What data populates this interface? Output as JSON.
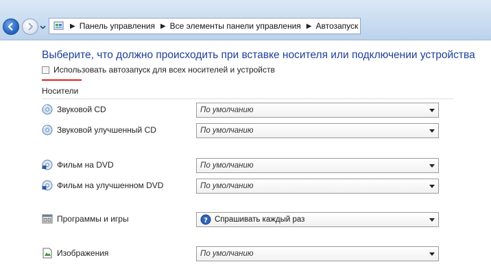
{
  "address_bar": {
    "breadcrumbs": [
      "Панель управления",
      "Все элементы панели управления",
      "Автозапуск"
    ]
  },
  "main": {
    "heading": "Выберите, что должно происходить при вставке носителя или подключении устройства",
    "use_autoplay_label": "Использовать автозапуск для всех носителей и устройств",
    "use_autoplay_checked": false,
    "section_label": "Носители",
    "media": [
      {
        "label": "Звуковой CD",
        "icon": "disc-icon",
        "value": "По умолчанию"
      },
      {
        "label": "Звуковой улучшенный CD",
        "icon": "disc-icon",
        "value": "По умолчанию"
      },
      {
        "label": "Фильм на DVD",
        "icon": "dvd-icon",
        "value": "По умолчанию"
      },
      {
        "label": "Фильм на улучшенном DVD",
        "icon": "dvd-icon",
        "value": "По умолчанию"
      },
      {
        "label": "Программы и игры",
        "icon": "programs-icon",
        "value": "Спрашивать каждый раз"
      },
      {
        "label": "Изображения",
        "icon": "image-icon",
        "value": "По умолчанию"
      }
    ]
  },
  "colors": {
    "heading": "#1e3f9a",
    "accent_underline": "#e0201c",
    "toolbar": "#c9dcf1"
  }
}
